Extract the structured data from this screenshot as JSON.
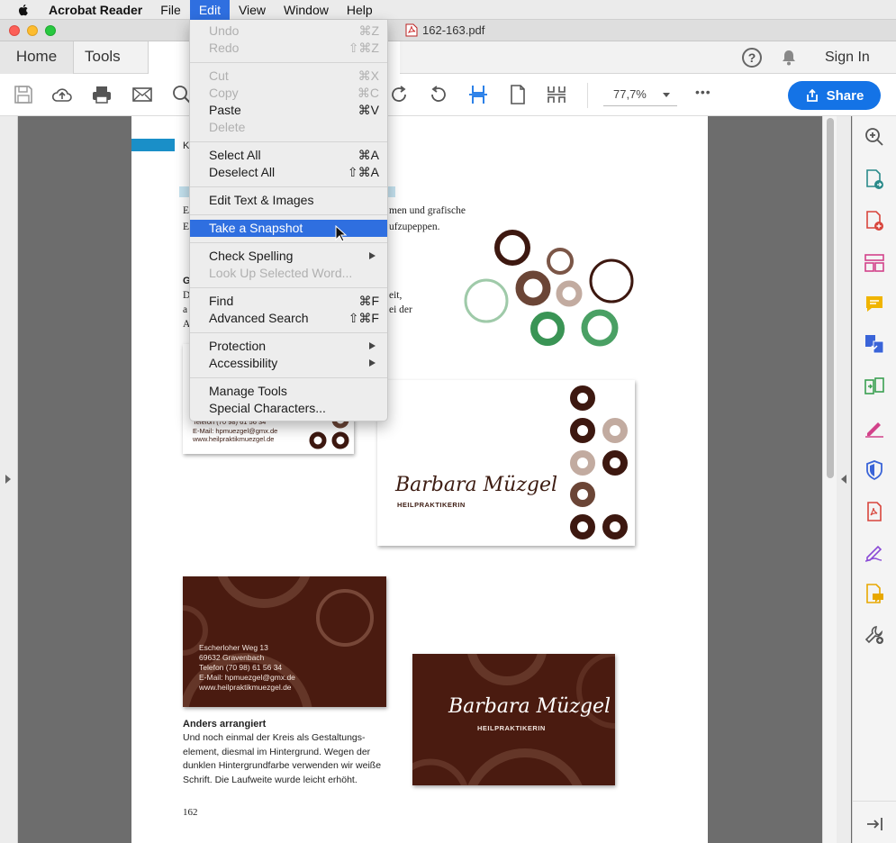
{
  "menubar": {
    "app": "Acrobat Reader",
    "items": [
      "File",
      "Edit",
      "View",
      "Window",
      "Help"
    ]
  },
  "window": {
    "title": "162-163.pdf"
  },
  "tabs": {
    "home": "Home",
    "tools": "Tools",
    "sign_in": "Sign In",
    "help": "?"
  },
  "toolbar": {
    "zoom": "77,7%",
    "share": "Share",
    "more": "•••"
  },
  "edit_menu": {
    "undo": "Undo",
    "undo_sc": "⌘Z",
    "redo": "Redo",
    "redo_sc": "⇧⌘Z",
    "cut": "Cut",
    "cut_sc": "⌘X",
    "copy": "Copy",
    "copy_sc": "⌘C",
    "paste": "Paste",
    "paste_sc": "⌘V",
    "delete": "Delete",
    "select_all": "Select All",
    "select_all_sc": "⌘A",
    "deselect_all": "Deselect All",
    "deselect_all_sc": "⇧⌘A",
    "edit_text": "Edit Text & Images",
    "snapshot": "Take a Snapshot",
    "check_spelling": "Check Spelling",
    "look_up": "Look Up Selected Word...",
    "find": "Find",
    "find_sc": "⌘F",
    "advanced_search": "Advanced Search",
    "advanced_search_sc": "⇧⌘F",
    "protection": "Protection",
    "accessibility": "Accessibility",
    "manage_tools": "Manage Tools",
    "special_chars": "Special Characters..."
  },
  "page": {
    "header_k": "K",
    "intro_line1_end": "men und grafische",
    "intro_line2_end": "ufzupeppen.",
    "intro_e1": "E",
    "intro_e2": "E",
    "para_g": "G",
    "para_d": "D",
    "para_a": "a",
    "para_a2": "A",
    "para_end1": "eit,",
    "para_end2": "ei der",
    "small_card": {
      "phone": "Telefon (70 98) 61 56 34",
      "email": "E-Mail: hpmuezgel@gmx.de",
      "web": "www.heilpraktikmuezgel.de"
    },
    "card_name": "Barbara Müzgel",
    "card_sub": "Heilpraktikerin",
    "dark_card": {
      "street": "Escherloher Weg 13",
      "city": "69632 Gravenbach",
      "phone": "Telefon (70 98) 61 56 34",
      "email": "E-Mail: hpmuezgel@gmx.de",
      "web": "www.heilpraktikmuezgel.de"
    },
    "caption_title": "Anders arrangiert",
    "caption_l1": "Und noch einmal der Kreis als Gestaltungs-",
    "caption_l2": "element, diesmal im Hintergrund. Wegen der",
    "caption_l3": "dunklen Hintergrundfarbe verwenden wir weiße",
    "caption_l4": "Schrift. Die Laufweite wurde leicht erhöht.",
    "page_number": "162"
  },
  "colors": {
    "accent": "#1473e6",
    "menu_highlight": "#2f6fe0",
    "card_brown": "#4a1b10",
    "ring_dark": "#3d1810",
    "ring_mid": "#6b4536",
    "ring_light": "#c2aba0",
    "ring_green": "#3a9455",
    "ring_pale_green": "#9fcaa9"
  }
}
